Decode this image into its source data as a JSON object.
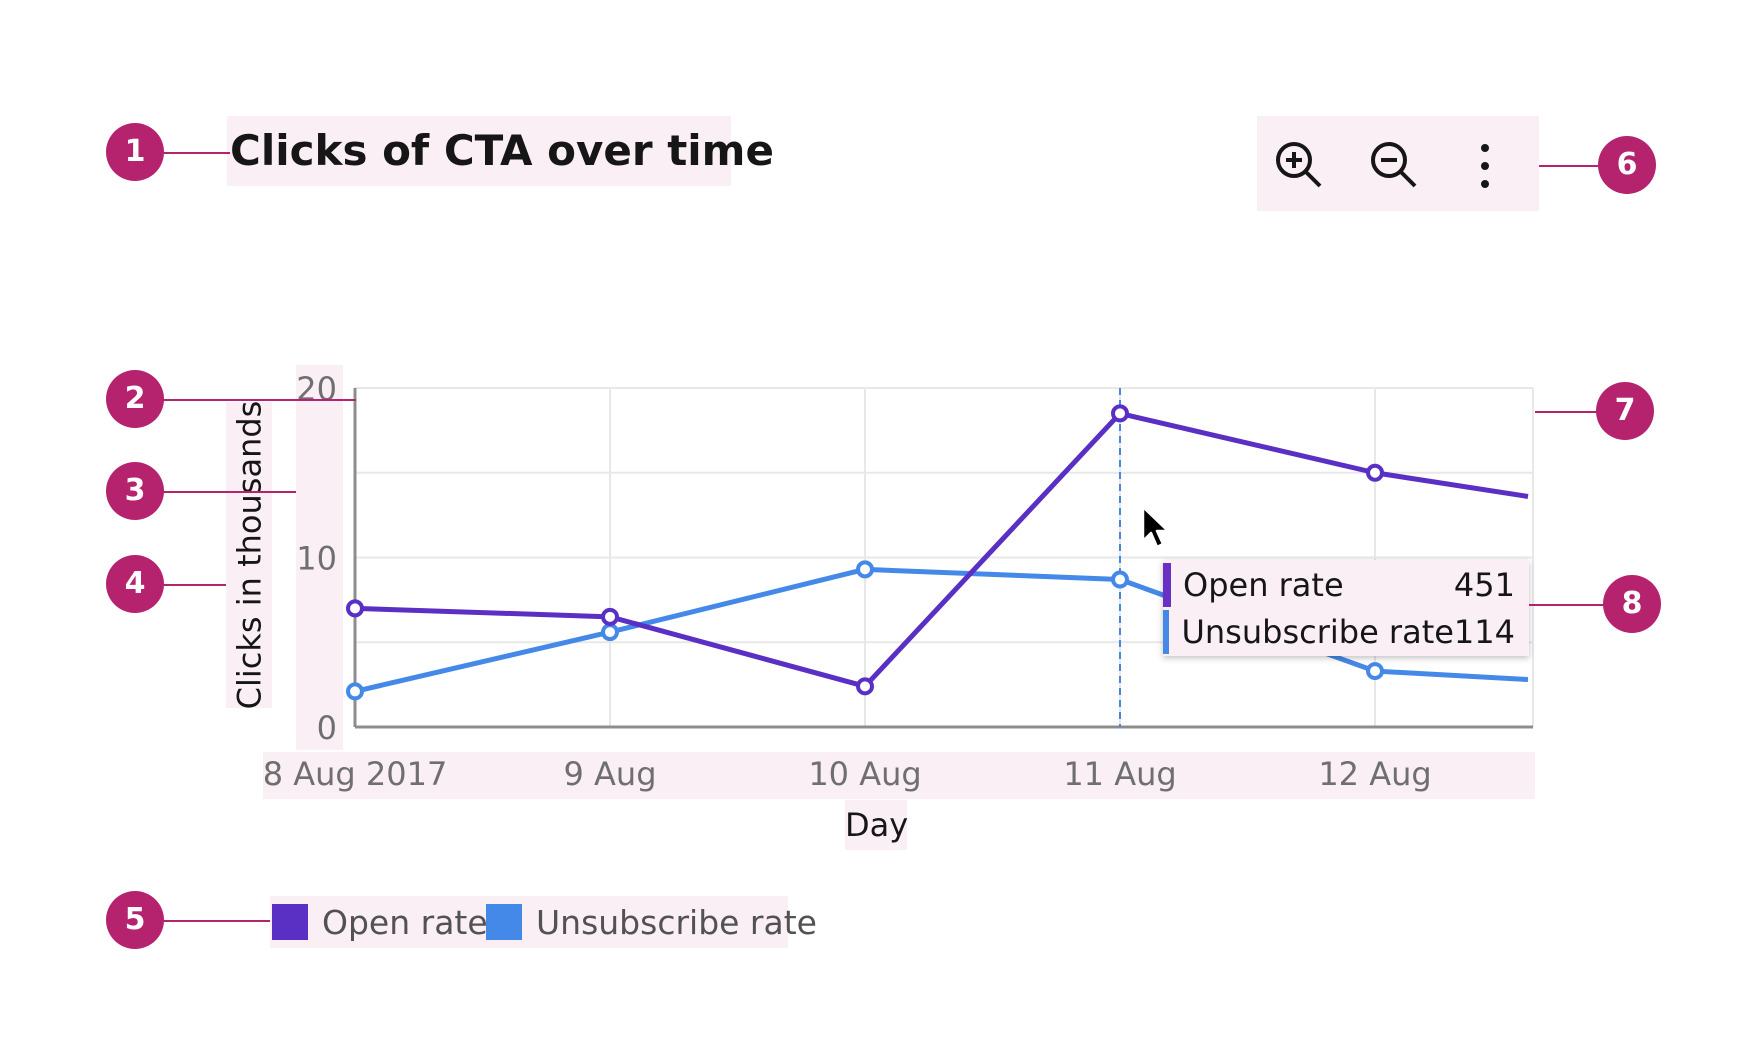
{
  "chart_title": "Clicks of CTA over time",
  "toolbar": {
    "zoom_in_icon": "zoom-in-icon",
    "zoom_out_icon": "zoom-out-icon",
    "overflow_icon": "overflow-menu-icon"
  },
  "callouts": [
    "1",
    "2",
    "3",
    "4",
    "5",
    "6",
    "7",
    "8"
  ],
  "tooltip": {
    "rows": [
      {
        "label": "Open rate",
        "value": "451",
        "color": "#6a2fc4"
      },
      {
        "label": "Unsubscribe rate",
        "value": "114",
        "color": "#4589e8"
      }
    ]
  },
  "chart_data": {
    "type": "line",
    "xlabel": "Day",
    "ylabel": "Clicks in thousands",
    "x": [
      "8 Aug 2017",
      "9 Aug",
      "10 Aug",
      "11 Aug",
      "12 Aug"
    ],
    "ylim": [
      0,
      20
    ],
    "yticks": [
      "0",
      "10",
      "20"
    ],
    "grid": true,
    "legend_position": "bottom-left",
    "series": [
      {
        "name": "Open rate",
        "color": "#5a2fc4",
        "values": [
          7.0,
          6.5,
          2.4,
          18.5,
          15.0,
          13.6
        ]
      },
      {
        "name": "Unsubscribe rate",
        "color": "#4589e8",
        "values": [
          2.1,
          5.6,
          9.3,
          8.7,
          3.3,
          2.8
        ]
      }
    ],
    "x_values_all": [
      0,
      1,
      2,
      3,
      4,
      4.6
    ],
    "hover_index": 3
  }
}
